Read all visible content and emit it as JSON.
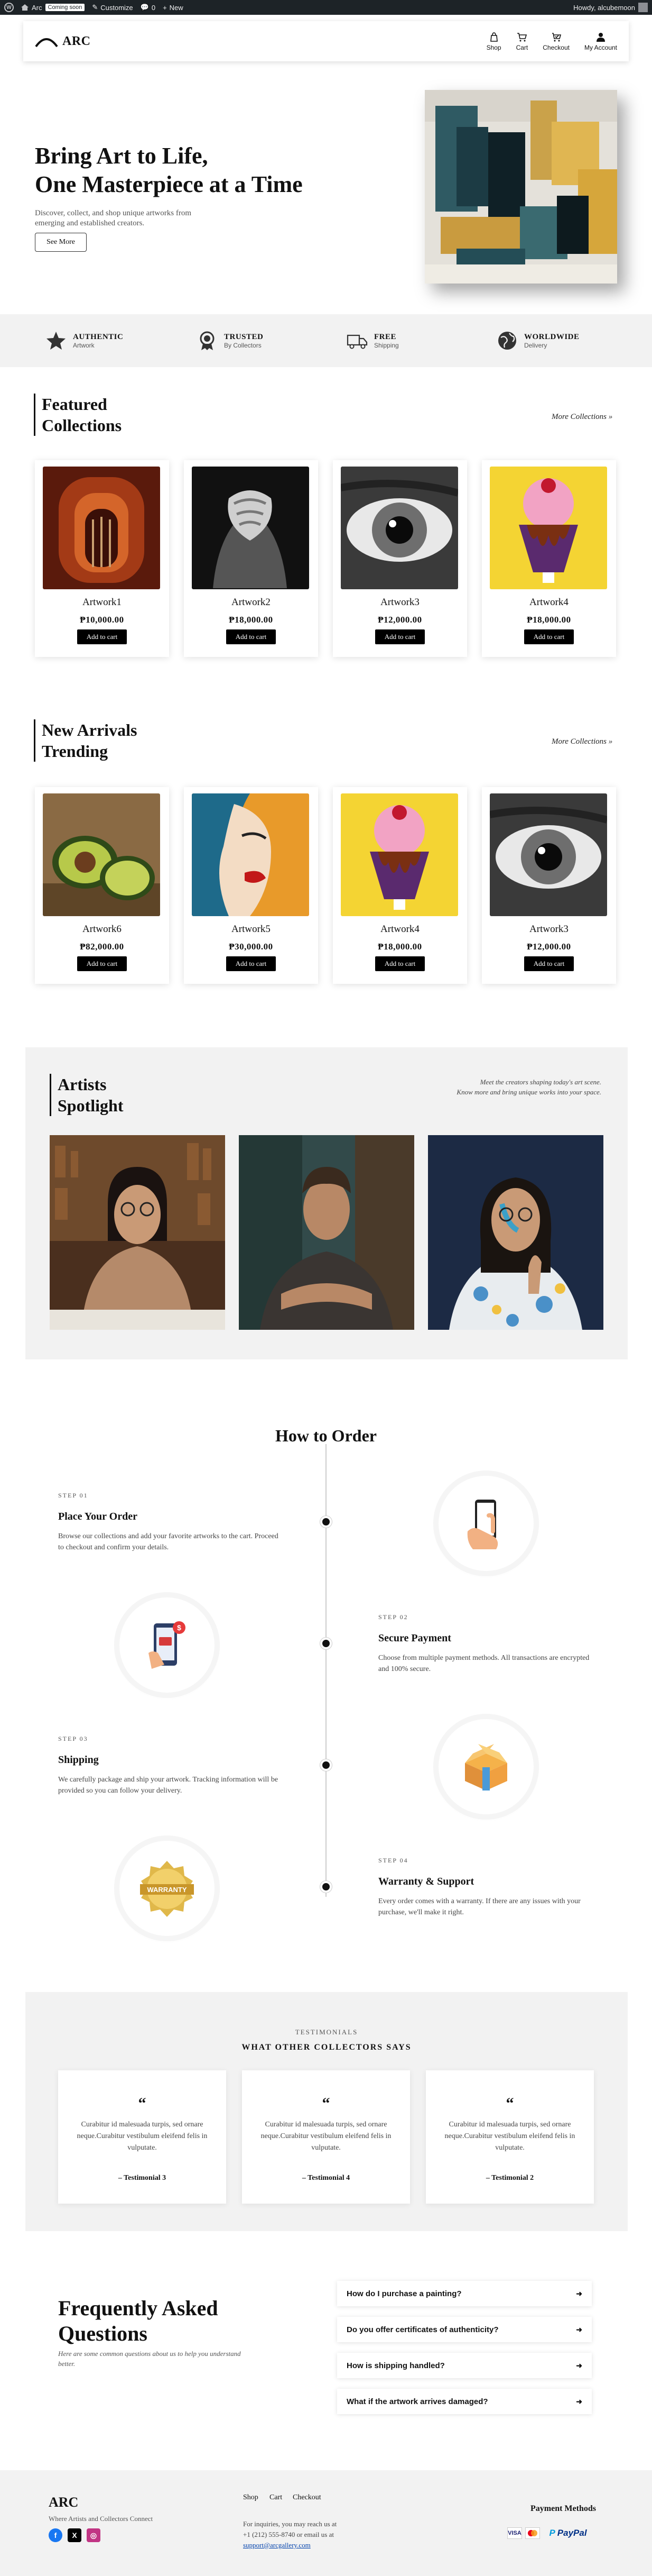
{
  "admin_bar": {
    "site_name": "Arc",
    "coming_soon": "Coming soon",
    "customize": "Customize",
    "comments": "0",
    "new": "New",
    "howdy": "Howdy, alcubemoon"
  },
  "header": {
    "logo_text": "ARC",
    "nav": [
      {
        "label": "Shop",
        "icon": "shop-icon"
      },
      {
        "label": "Cart",
        "icon": "cart-icon"
      },
      {
        "label": "Checkout",
        "icon": "checkout-icon"
      },
      {
        "label": "My Account",
        "icon": "account-icon"
      }
    ]
  },
  "hero": {
    "title_line1": "Bring Art to Life,",
    "title_line2": "One Masterpiece at a Time",
    "description": "Discover, collect, and shop unique artworks from emerging and established creators.",
    "button": "See More"
  },
  "features": [
    {
      "title": "AUTHENTIC",
      "subtitle": "Artwork",
      "icon": "star-icon"
    },
    {
      "title": "TRUSTED",
      "subtitle": "By Collectors",
      "icon": "badge-icon"
    },
    {
      "title": "FREE",
      "subtitle": "Shipping",
      "icon": "truck-icon"
    },
    {
      "title": "WORLDWIDE",
      "subtitle": "Delivery",
      "icon": "globe-icon"
    }
  ],
  "featured": {
    "title_line1": "Featured",
    "title_line2": "Collections",
    "more": "More Collections »",
    "products": [
      {
        "name": "Artwork1",
        "price": "₱10,000.00",
        "button": "Add to cart"
      },
      {
        "name": "Artwork2",
        "price": "₱18,000.00",
        "button": "Add to cart"
      },
      {
        "name": "Artwork3",
        "price": "₱12,000.00",
        "button": "Add to cart"
      },
      {
        "name": "Artwork4",
        "price": "₱18,000.00",
        "button": "Add to cart"
      }
    ]
  },
  "arrivals": {
    "title_line1": "New Arrivals",
    "title_line2": "Trending",
    "more": "More Collections »",
    "products": [
      {
        "name": "Artwork6",
        "price": "₱82,000.00",
        "button": "Add to cart"
      },
      {
        "name": "Artwork5",
        "price": "₱30,000.00",
        "button": "Add to cart"
      },
      {
        "name": "Artwork4",
        "price": "₱18,000.00",
        "button": "Add to cart"
      },
      {
        "name": "Artwork3",
        "price": "₱12,000.00",
        "button": "Add to cart"
      }
    ]
  },
  "artists": {
    "title_line1": "Artists",
    "title_line2": "Spotlight",
    "note_line1": "Meet the creators shaping today's art scene.",
    "note_line2": "Know more and bring unique works into your space."
  },
  "how_to_order": {
    "title": "How to Order",
    "steps": [
      {
        "label": "STEP 01",
        "title": "Place Your Order",
        "desc": "Browse our collections and add your favorite artworks to the cart. Proceed to checkout and confirm your details."
      },
      {
        "label": "STEP 02",
        "title": "Secure Payment",
        "desc": "Choose from multiple payment methods. All transactions are encrypted and 100% secure."
      },
      {
        "label": "STEP 03",
        "title": "Shipping",
        "desc": "We carefully package and ship your artwork. Tracking information will be provided so you can follow your delivery."
      },
      {
        "label": "STEP 04",
        "title": "Warranty & Support",
        "desc": "Every order comes with a warranty. If there are any issues with your purchase, we'll make it right."
      }
    ],
    "warranty_badge": "WARRANTY"
  },
  "testimonials": {
    "subtitle": "TESTIMONIALS",
    "title": "WHAT OTHER COLLECTORS SAYS",
    "items": [
      {
        "text": "Curabitur id malesuada turpis, sed ornare neque.Curabitur vestibulum eleifend felis in vulputate.",
        "author": "– Testimonial 3"
      },
      {
        "text": "Curabitur id malesuada turpis, sed ornare neque.Curabitur vestibulum eleifend felis in vulputate.",
        "author": "– Testimonial 4"
      },
      {
        "text": "Curabitur id malesuada turpis, sed ornare neque.Curabitur vestibulum eleifend felis in vulputate.",
        "author": "– Testimonial 2"
      }
    ]
  },
  "faq": {
    "title_line1": "Frequently Asked",
    "title_line2": "Questions",
    "description": "Here are some common questions about us to help you understand better.",
    "items": [
      "How do I purchase a painting?",
      "Do you offer certificates of authenticity?",
      "How is shipping handled?",
      "What if the artwork arrives damaged?"
    ]
  },
  "footer": {
    "brand": "ARC",
    "tagline": "Where Artists and Collectors Connect",
    "links": [
      "Shop",
      "Cart",
      "Checkout"
    ],
    "contact_line1": "For inquiries, you may reach us at",
    "contact_line2": "+1 (212) 555-8740 or email us at",
    "email": "support@arcgallery.com",
    "payment_title": "Payment Methods",
    "payments": [
      "VISA",
      "MC",
      "PayPal"
    ]
  },
  "colors": {
    "accent": "#111111",
    "section_bg": "#f2f2f2",
    "admin_bar": "#1d2327"
  }
}
